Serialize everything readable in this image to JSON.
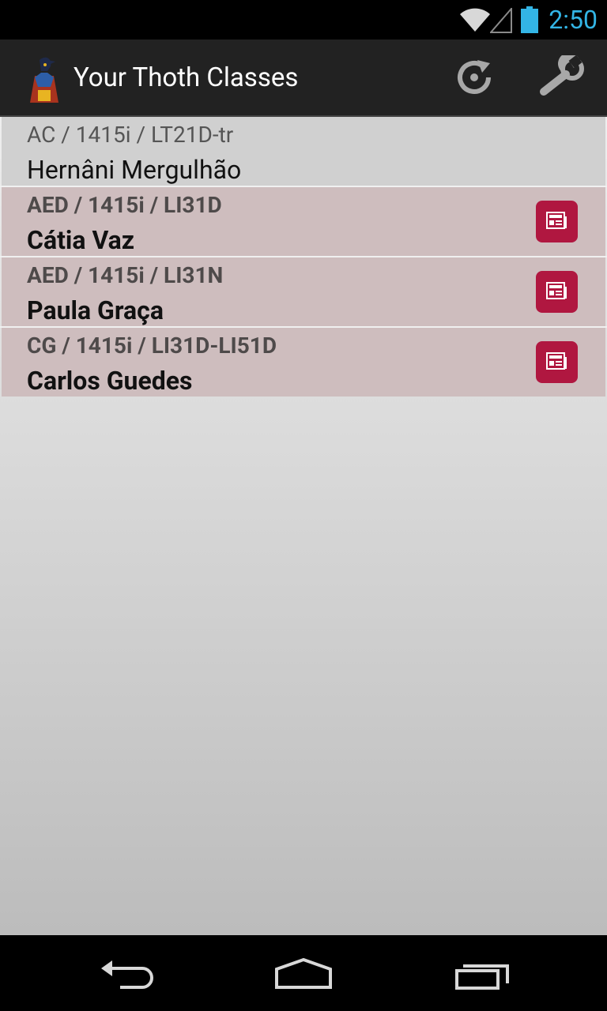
{
  "status_bar": {
    "time": "2:50",
    "accent_color": "#33b5e5",
    "icons": [
      "wifi-icon",
      "signal-icon",
      "battery-icon"
    ]
  },
  "action_bar": {
    "title": "Your Thoth Classes",
    "app_icon": "thoth-logo-icon",
    "actions": [
      {
        "name": "refresh",
        "icon": "refresh-icon"
      },
      {
        "name": "settings",
        "icon": "wrench-icon"
      }
    ]
  },
  "classes": [
    {
      "meta": "AC / 1415i / LT21D-tr",
      "teacher": "Hernâni Mergulhão",
      "has_news": false
    },
    {
      "meta": "AED / 1415i / LI31D",
      "teacher": "Cátia Vaz",
      "has_news": true
    },
    {
      "meta": "AED / 1415i / LI31N",
      "teacher": "Paula Graça",
      "has_news": true
    },
    {
      "meta": "CG / 1415i / LI31D-LI51D",
      "teacher": "Carlos Guedes",
      "has_news": true
    }
  ],
  "colors": {
    "news_button": "#b01740",
    "accent_row": "#cebdbe",
    "plain_row": "#d0d0d0"
  },
  "nav_bar": {
    "buttons": [
      "back-icon",
      "home-icon",
      "recents-icon"
    ]
  }
}
